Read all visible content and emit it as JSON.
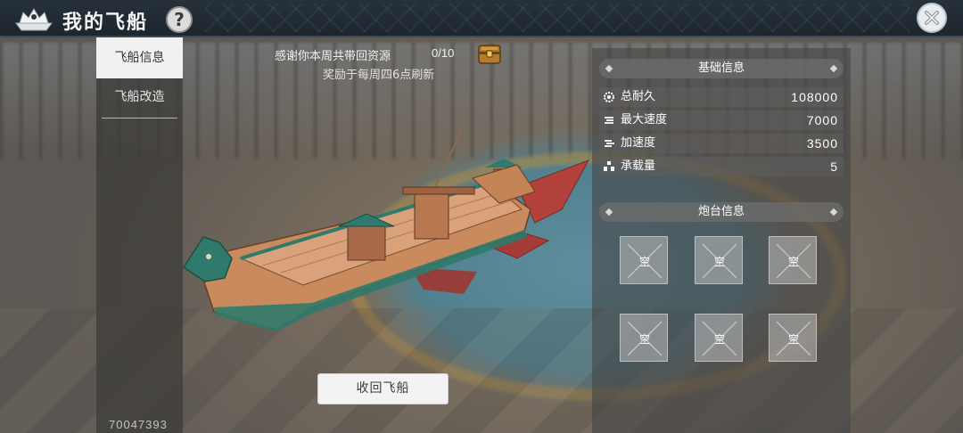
{
  "header": {
    "title": "我的飞船",
    "help_label": "?"
  },
  "sidebar": {
    "tabs": [
      {
        "label": "飞船信息",
        "selected": true
      },
      {
        "label": "飞船改造",
        "selected": false
      }
    ]
  },
  "reward": {
    "message": "感谢你本周共带回资源",
    "count": "0/10",
    "refresh_note": "奖励于每周四6点刷新"
  },
  "actions": {
    "recall_label": "收回飞船"
  },
  "basic_info": {
    "title": "基础信息",
    "stats": [
      {
        "icon": "gear-icon",
        "label": "总耐久",
        "value": "108000"
      },
      {
        "icon": "speed-icon",
        "label": "最大速度",
        "value": "7000"
      },
      {
        "icon": "acceleration-icon",
        "label": "加速度",
        "value": "3500"
      },
      {
        "icon": "cargo-icon",
        "label": "承载量",
        "value": "5"
      }
    ]
  },
  "turret_info": {
    "title": "炮台信息",
    "slots": [
      {
        "label": "空"
      },
      {
        "label": "空"
      },
      {
        "label": "空"
      },
      {
        "label": "空"
      },
      {
        "label": "空"
      },
      {
        "label": "空"
      }
    ]
  },
  "footer": {
    "user_id": "70047393"
  },
  "colors": {
    "topbar": "#1d262d",
    "selected_tab": "#f1f1f1",
    "panel": "#464646",
    "ship_hull": "#c98a5e",
    "ship_trim": "#2f7a6c",
    "ship_fin": "#b2413c"
  }
}
